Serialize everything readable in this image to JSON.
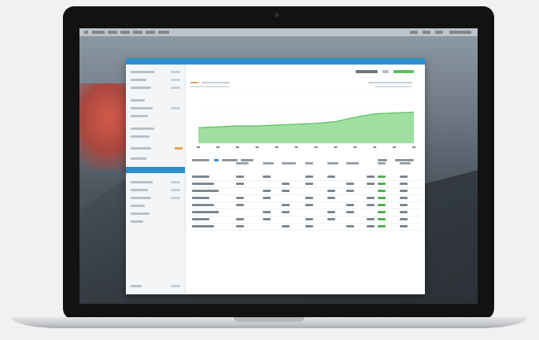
{
  "device": "laptop",
  "app": {
    "title": "",
    "header_buttons": [
      "",
      ""
    ],
    "accent_color": "#2d8fd0",
    "positive_color": "#4caf50",
    "sidebar": {
      "item_count": 14,
      "active_index": 8
    },
    "chart_data": {
      "type": "area",
      "title": "",
      "xlabel": "",
      "ylabel": "",
      "x": [
        1,
        2,
        3,
        4,
        5,
        6,
        7,
        8,
        9,
        10,
        11,
        12
      ],
      "series": [
        {
          "name": "",
          "values": [
            18,
            19,
            20,
            20,
            21,
            22,
            23,
            25,
            30,
            34,
            35,
            36
          ]
        }
      ],
      "ylim": [
        0,
        60
      ],
      "color": "#5cbf5c"
    },
    "table": {
      "columns": 10,
      "rows": 8
    }
  },
  "icons": [
    "camera-icon",
    "apple-menu-icon"
  ]
}
